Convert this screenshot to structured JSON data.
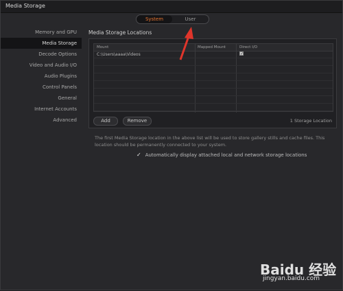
{
  "window": {
    "title": "Media Storage"
  },
  "segmented": {
    "system": "System",
    "user": "User"
  },
  "sidebar": {
    "items": [
      {
        "label": "Memory and GPU"
      },
      {
        "label": "Media Storage"
      },
      {
        "label": "Decode Options"
      },
      {
        "label": "Video and Audio I/O"
      },
      {
        "label": "Audio Plugins"
      },
      {
        "label": "Control Panels"
      },
      {
        "label": "General"
      },
      {
        "label": "Internet Accounts"
      },
      {
        "label": "Advanced"
      }
    ]
  },
  "main": {
    "section_title": "Media Storage Locations",
    "table": {
      "headers": {
        "mount": "Mount",
        "mapped": "Mapped Mount",
        "direct": "Direct I/O"
      },
      "rows": [
        {
          "mount": "C:\\Users\\aaaa\\Videos",
          "mapped": "",
          "direct_io": true
        }
      ]
    },
    "add_label": "Add",
    "remove_label": "Remove",
    "storage_count": "1 Storage Location",
    "note": "The first Media Storage location in the above list will be used to store gallery stills and cache files. This location should be permanently connected to your system.",
    "auto_display_label": "Automatically display attached local and network storage locations",
    "auto_display_checked": true
  },
  "watermark": {
    "logo": "Baidu 经验",
    "url": "jingyan.baidu.com"
  },
  "colors": {
    "accent": "#e8742f",
    "arrow": "#e0352b"
  }
}
